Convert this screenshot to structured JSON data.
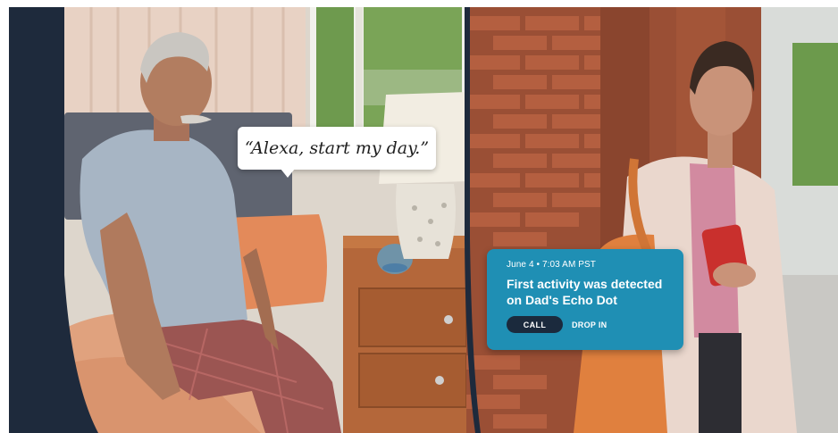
{
  "left_panel": {
    "speech_bubble": "“Alexa, start my day.”"
  },
  "notification": {
    "timestamp": "June 4 • 7:03 AM PST",
    "message": "First activity was detected on Dad's Echo Dot",
    "call_label": "CALL",
    "drop_in_label": "DROP IN"
  },
  "colors": {
    "frame_navy": "#1e2a3c",
    "notification_blue": "#1f8fb4",
    "call_button": "#1b2a3d"
  }
}
